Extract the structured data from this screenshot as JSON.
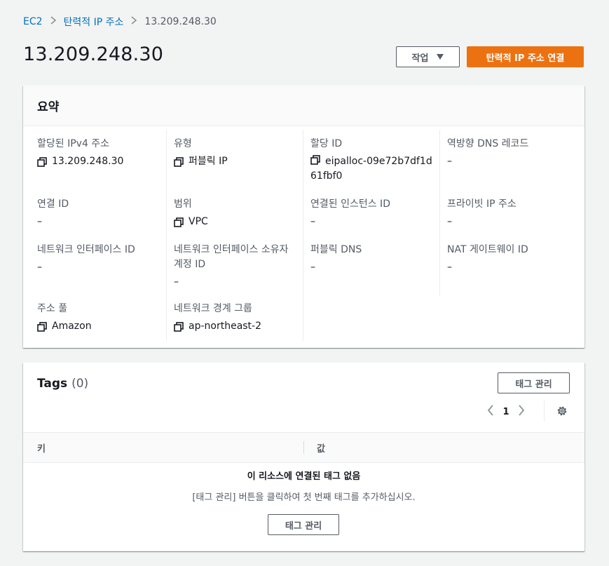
{
  "breadcrumb": {
    "root": "EC2",
    "section": "탄력적 IP 주소",
    "current": "13.209.248.30"
  },
  "page": {
    "title": "13.209.248.30"
  },
  "actions": {
    "actions_label": "작업",
    "associate_label": "탄력적 IP 주소 연결"
  },
  "summary": {
    "title": "요약",
    "fields": {
      "allocated_ipv4": {
        "label": "할당된 IPv4 주소",
        "value": "13.209.248.30"
      },
      "type": {
        "label": "유형",
        "value": "퍼블릭 IP"
      },
      "allocation_id": {
        "label": "할당 ID",
        "value": "eipalloc-09e72b7df1d61fbf0"
      },
      "reverse_dns": {
        "label": "역방향 DNS 레코드",
        "value": "–"
      },
      "association_id": {
        "label": "연결 ID",
        "value": "–"
      },
      "scope": {
        "label": "범위",
        "value": "VPC"
      },
      "associated_instance": {
        "label": "연결된 인스턴스 ID",
        "value": "–"
      },
      "private_ip": {
        "label": "프라이빗 IP 주소",
        "value": "–"
      },
      "eni_id": {
        "label": "네트워크 인터페이스 ID",
        "value": "–"
      },
      "eni_owner": {
        "label": "네트워크 인터페이스 소유자 계정 ID",
        "value": "–"
      },
      "public_dns": {
        "label": "퍼블릭 DNS",
        "value": "–"
      },
      "nat_gateway": {
        "label": "NAT 게이트웨이 ID",
        "value": "–"
      },
      "address_pool": {
        "label": "주소 풀",
        "value": "Amazon"
      },
      "border_group": {
        "label": "네트워크 경계 그룹",
        "value": "ap-northeast-2"
      }
    }
  },
  "tags": {
    "title": "Tags",
    "count": "(0)",
    "manage_label": "태그 관리",
    "page_number": "1",
    "columns": {
      "key": "키",
      "value": "값"
    },
    "empty_title": "이 리소스에 연결된 태그 없음",
    "empty_description": "[태그 관리] 버튼을 클릭하여 첫 번째 태그를 추가하십시오.",
    "empty_manage_label": "태그 관리"
  },
  "icons": {
    "copy": "copy-icon",
    "gear": "gear-icon",
    "chevron_left": "chevron-left-icon",
    "chevron_right": "chevron-right-icon",
    "caret_down": "caret-down-icon"
  },
  "colors": {
    "link": "#0073bb",
    "primary": "#ec7211",
    "background": "#f2f3f3"
  }
}
